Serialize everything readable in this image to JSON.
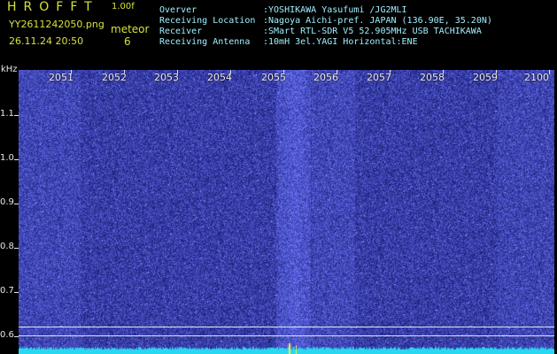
{
  "header": {
    "app_name": "HROFFT",
    "version": "1.00f",
    "filename": "YY2611242050.png",
    "datetime": "26.11.24 20:50",
    "meteor_label": "meteor",
    "meteor_count": "6"
  },
  "station_info": [
    {
      "key": "Overver",
      "value": ":YOSHIKAWA Yasufumi /JG2MLI"
    },
    {
      "key": "Receiving Location",
      "value": ":Nagoya Aichi-pref. JAPAN (136.90E, 35.20N)"
    },
    {
      "key": "Receiver",
      "value": ":SMart RTL-SDR V5 52.905MHz USB TACHIKAWA"
    },
    {
      "key": "Receiving Antenna",
      "value": ":10mH 3el.YAGI Horizontal:ENE"
    }
  ],
  "y_axis": {
    "unit": "kHz",
    "ticks": [
      "1.1",
      "1.0",
      "0.9",
      "0.8",
      "0.7",
      "0.6"
    ]
  },
  "x_axis": {
    "ticks": [
      "2051",
      "2052",
      "2053",
      "2054",
      "2055",
      "2056",
      "2057",
      "2058",
      "2059",
      "2100"
    ]
  },
  "colors": {
    "background": "#000000",
    "plot_base": "#1b1c86",
    "header_text": "#d6e23a",
    "info_text": "#9ef0ff",
    "trace": "#29d8f0"
  }
}
